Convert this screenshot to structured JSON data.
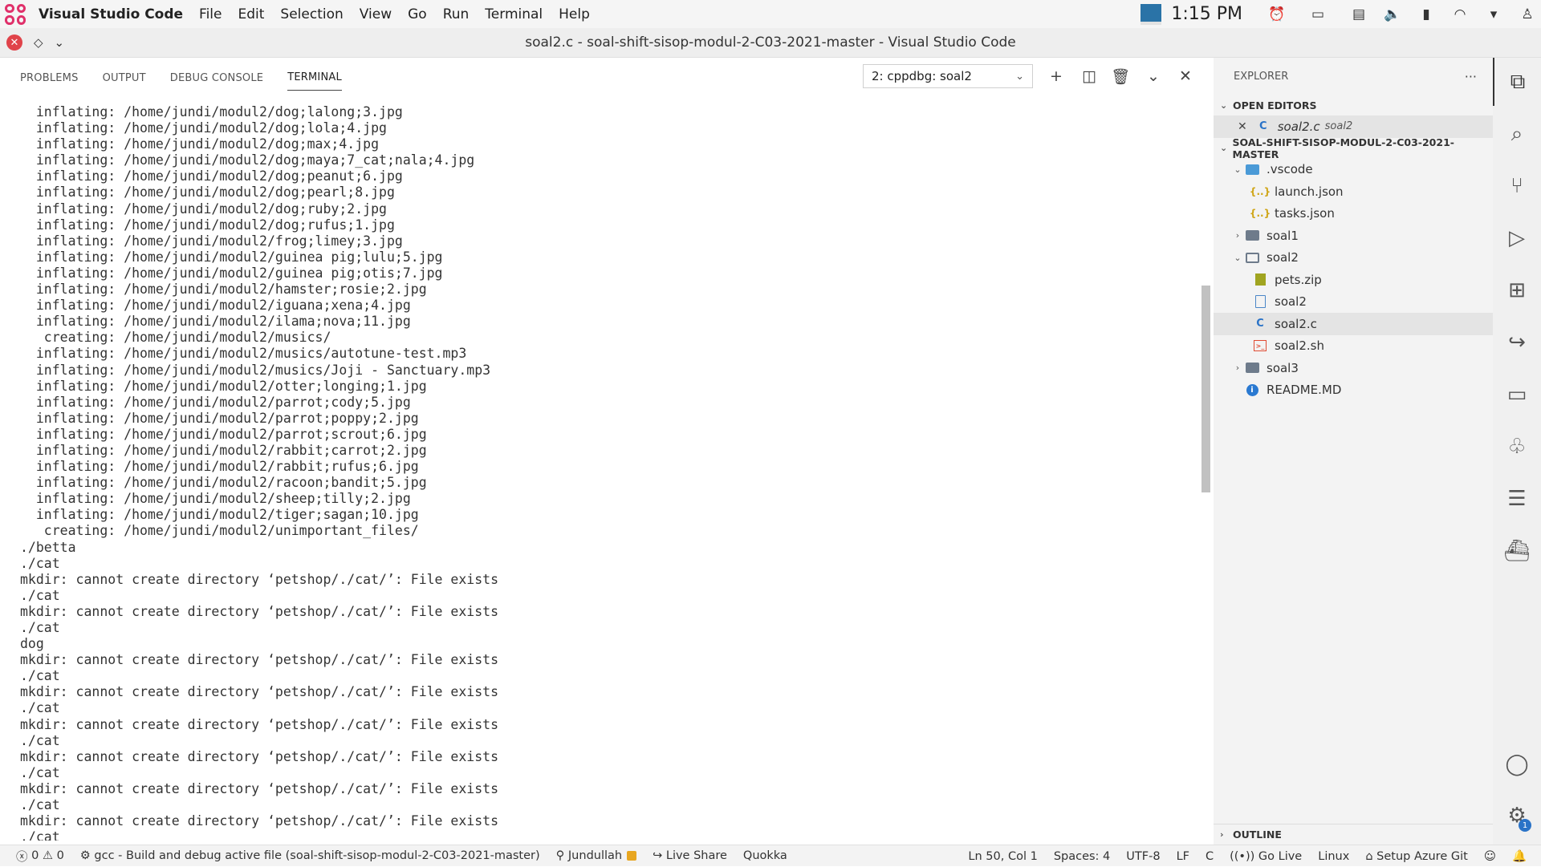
{
  "topbar": {
    "app_name": "Visual Studio Code",
    "menus": [
      "File",
      "Edit",
      "Selection",
      "View",
      "Go",
      "Run",
      "Terminal",
      "Help"
    ],
    "clock": "1:15 PM"
  },
  "window": {
    "title": "soal2.c - soal-shift-sisop-modul-2-C03-2021-master - Visual Studio Code"
  },
  "panel": {
    "tabs": [
      "PROBLEMS",
      "OUTPUT",
      "DEBUG CONSOLE",
      "TERMINAL"
    ],
    "active_tab": "TERMINAL",
    "terminal_select": "2: cppdbg: soal2",
    "terminal_lines": [
      "  inflating: /home/jundi/modul2/dog;lalong;3.jpg",
      "  inflating: /home/jundi/modul2/dog;lola;4.jpg",
      "  inflating: /home/jundi/modul2/dog;max;4.jpg",
      "  inflating: /home/jundi/modul2/dog;maya;7_cat;nala;4.jpg",
      "  inflating: /home/jundi/modul2/dog;peanut;6.jpg",
      "  inflating: /home/jundi/modul2/dog;pearl;8.jpg",
      "  inflating: /home/jundi/modul2/dog;ruby;2.jpg",
      "  inflating: /home/jundi/modul2/dog;rufus;1.jpg",
      "  inflating: /home/jundi/modul2/frog;limey;3.jpg",
      "  inflating: /home/jundi/modul2/guinea pig;lulu;5.jpg",
      "  inflating: /home/jundi/modul2/guinea pig;otis;7.jpg",
      "  inflating: /home/jundi/modul2/hamster;rosie;2.jpg",
      "  inflating: /home/jundi/modul2/iguana;xena;4.jpg",
      "  inflating: /home/jundi/modul2/ilama;nova;11.jpg",
      "   creating: /home/jundi/modul2/musics/",
      "  inflating: /home/jundi/modul2/musics/autotune-test.mp3",
      "  inflating: /home/jundi/modul2/musics/Joji - Sanctuary.mp3",
      "  inflating: /home/jundi/modul2/otter;longing;1.jpg",
      "  inflating: /home/jundi/modul2/parrot;cody;5.jpg",
      "  inflating: /home/jundi/modul2/parrot;poppy;2.jpg",
      "  inflating: /home/jundi/modul2/parrot;scrout;6.jpg",
      "  inflating: /home/jundi/modul2/rabbit;carrot;2.jpg",
      "  inflating: /home/jundi/modul2/rabbit;rufus;6.jpg",
      "  inflating: /home/jundi/modul2/racoon;bandit;5.jpg",
      "  inflating: /home/jundi/modul2/sheep;tilly;2.jpg",
      "  inflating: /home/jundi/modul2/tiger;sagan;10.jpg",
      "   creating: /home/jundi/modul2/unimportant_files/",
      "./betta",
      "./cat",
      "mkdir: cannot create directory ‘petshop/./cat/’: File exists",
      "./cat",
      "mkdir: cannot create directory ‘petshop/./cat/’: File exists",
      "./cat",
      "dog",
      "mkdir: cannot create directory ‘petshop/./cat/’: File exists",
      "./cat",
      "mkdir: cannot create directory ‘petshop/./cat/’: File exists",
      "./cat",
      "mkdir: cannot create directory ‘petshop/./cat/’: File exists",
      "./cat",
      "mkdir: cannot create directory ‘petshop/./cat/’: File exists",
      "./cat",
      "mkdir: cannot create directory ‘petshop/./cat/’: File exists",
      "./cat",
      "mkdir: cannot create directory ‘petshop/./cat/’: File exists",
      "./cat"
    ]
  },
  "explorer": {
    "title": "EXPLORER",
    "open_editors_label": "OPEN EDITORS",
    "open_editor": {
      "name": "soal2.c",
      "desc": "soal2"
    },
    "workspace_label": "SOAL-SHIFT-SISOP-MODUL-2-C03-2021-MASTER",
    "tree": [
      {
        "label": ".vscode",
        "icon": "vscode-folder-icon",
        "twisty": "open",
        "depth": 1
      },
      {
        "label": "launch.json",
        "icon": "json-icon",
        "twisty": "",
        "depth": 2
      },
      {
        "label": "tasks.json",
        "icon": "json-icon",
        "twisty": "",
        "depth": 2
      },
      {
        "label": "soal1",
        "icon": "folder-icon",
        "twisty": "closed",
        "depth": 1
      },
      {
        "label": "soal2",
        "icon": "folder-open-icon",
        "twisty": "open",
        "depth": 1
      },
      {
        "label": "pets.zip",
        "icon": "zip-icon",
        "twisty": "",
        "depth": 2
      },
      {
        "label": "soal2",
        "icon": "file-icon",
        "twisty": "",
        "depth": 2
      },
      {
        "label": "soal2.c",
        "icon": "c-icon",
        "twisty": "",
        "depth": 2,
        "selected": true
      },
      {
        "label": "soal2.sh",
        "icon": "shell-icon",
        "twisty": "",
        "depth": 2
      },
      {
        "label": "soal3",
        "icon": "folder-icon",
        "twisty": "closed",
        "depth": 1
      },
      {
        "label": "README.MD",
        "icon": "info-icon",
        "twisty": "",
        "depth": 1
      }
    ],
    "outline_label": "OUTLINE"
  },
  "activitybar": {
    "items": [
      "explorer-icon",
      "search-icon",
      "source-control-icon",
      "run-debug-icon",
      "extensions-icon",
      "live-share-icon",
      "remote-explorer-icon",
      "tree-icon",
      "database-icon",
      "docker-icon"
    ],
    "settings_badge": "1"
  },
  "statusbar": {
    "errors": "0",
    "warnings": "0",
    "task": "gcc - Build and debug active file (soal-shift-sisop-modul-2-C03-2021-master)",
    "user": "Jundullah",
    "live_share": "Live Share",
    "quokka": "Quokka",
    "position": "Ln 50, Col 1",
    "spaces": "Spaces: 4",
    "encoding": "UTF-8",
    "eol": "LF",
    "language": "C",
    "go_live": "Go Live",
    "platform": "Linux",
    "azure": "Setup Azure Git"
  }
}
